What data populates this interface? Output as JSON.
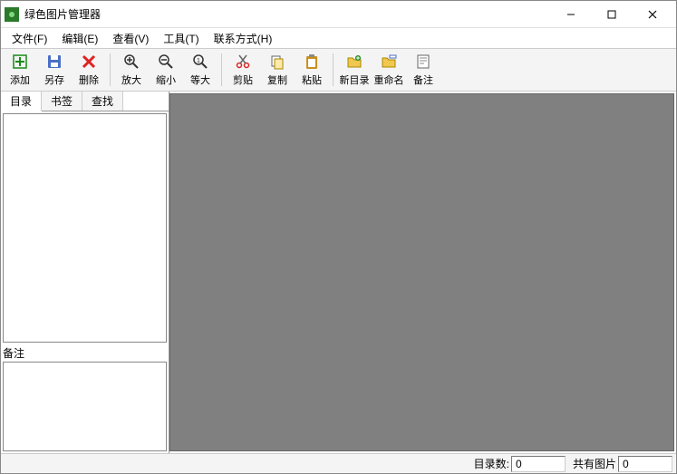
{
  "app": {
    "title": "绿色图片管理器"
  },
  "menubar": {
    "file": "文件(F)",
    "edit": "编辑(E)",
    "view": "查看(V)",
    "tools": "工具(T)",
    "contact": "联系方式(H)"
  },
  "toolbar": {
    "add": "添加",
    "saveas": "另存",
    "delete": "删除",
    "zoomin": "放大",
    "zoomout": "缩小",
    "actual": "等大",
    "cut": "剪贴",
    "copy": "复制",
    "paste": "粘贴",
    "newfolder": "新目录",
    "rename": "重命名",
    "remark": "备注"
  },
  "tabs": {
    "dir": "目录",
    "bookmark": "书签",
    "find": "查找"
  },
  "note": {
    "label": "备注"
  },
  "status": {
    "dircount_label": "目录数:",
    "dircount_value": "0",
    "imgcount_label": "共有图片",
    "imgcount_value": "0"
  }
}
